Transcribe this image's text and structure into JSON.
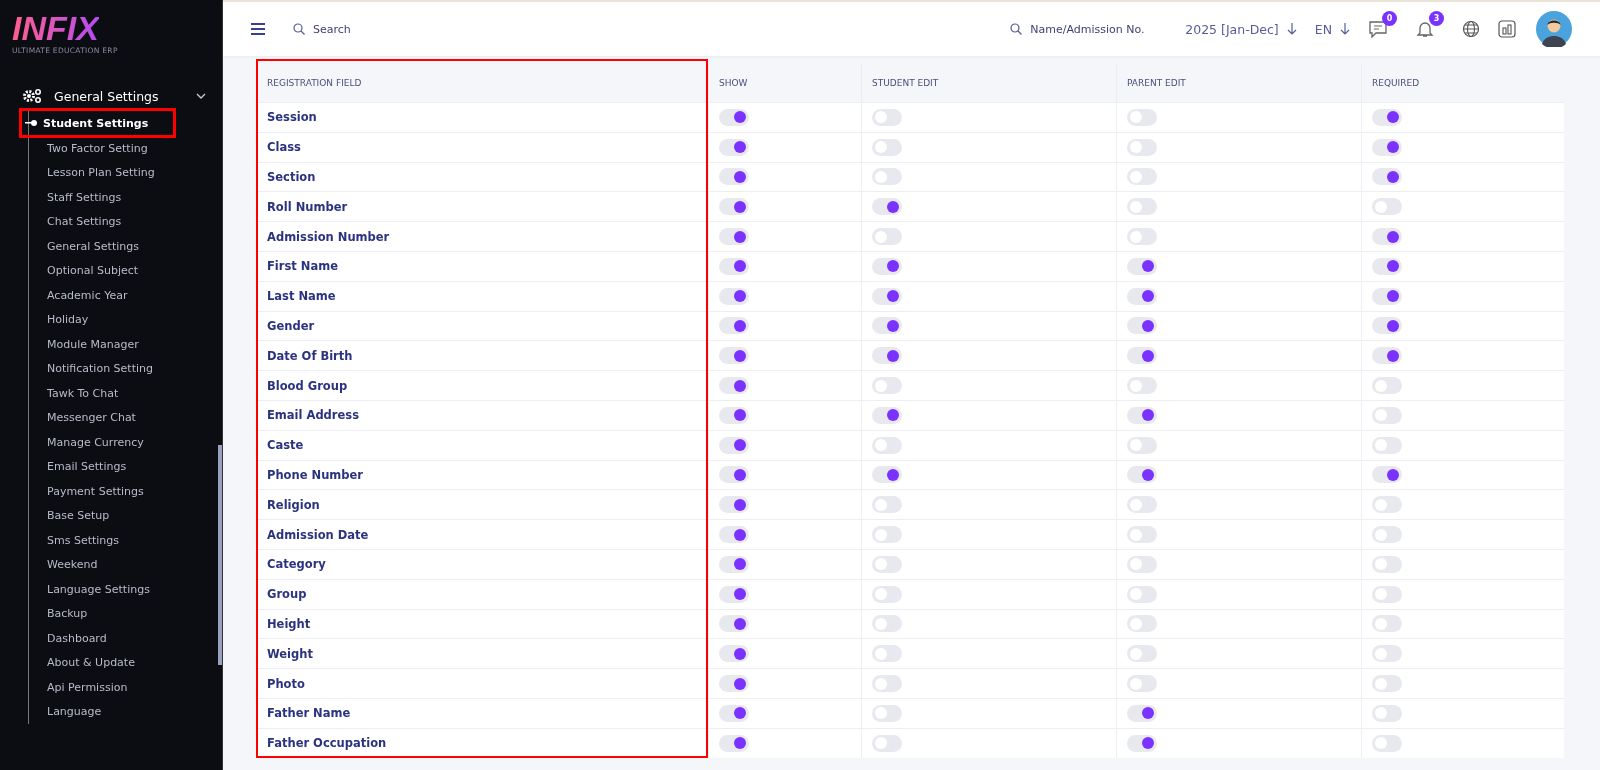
{
  "logo": {
    "name": "INFIX",
    "tagline": "ULTIMATE EDUCATION ERP"
  },
  "sidebar": {
    "group": {
      "label": "General Settings",
      "expanded": true
    },
    "items": [
      {
        "label": "Student Settings",
        "selected": true,
        "highlighted": true
      },
      {
        "label": "Two Factor Setting",
        "selected": false
      },
      {
        "label": "Lesson Plan Setting",
        "selected": false
      },
      {
        "label": "Staff Settings",
        "selected": false
      },
      {
        "label": "Chat Settings",
        "selected": false
      },
      {
        "label": "General Settings",
        "selected": false
      },
      {
        "label": "Optional Subject",
        "selected": false
      },
      {
        "label": "Academic Year",
        "selected": false
      },
      {
        "label": "Holiday",
        "selected": false
      },
      {
        "label": "Module Manager",
        "selected": false
      },
      {
        "label": "Notification Setting",
        "selected": false
      },
      {
        "label": "Tawk To Chat",
        "selected": false
      },
      {
        "label": "Messenger Chat",
        "selected": false
      },
      {
        "label": "Manage Currency",
        "selected": false
      },
      {
        "label": "Email Settings",
        "selected": false
      },
      {
        "label": "Payment Settings",
        "selected": false
      },
      {
        "label": "Base Setup",
        "selected": false
      },
      {
        "label": "Sms Settings",
        "selected": false
      },
      {
        "label": "Weekend",
        "selected": false
      },
      {
        "label": "Language Settings",
        "selected": false
      },
      {
        "label": "Backup",
        "selected": false
      },
      {
        "label": "Dashboard",
        "selected": false
      },
      {
        "label": "About & Update",
        "selected": false
      },
      {
        "label": "Api Permission",
        "selected": false
      },
      {
        "label": "Language",
        "selected": false
      }
    ]
  },
  "topbar": {
    "search_placeholder": "Search",
    "student_search_placeholder": "Name/Admission No.",
    "session": "2025 [Jan-Dec]",
    "language": "EN",
    "messages_count": "0",
    "notifications_count": "3"
  },
  "table": {
    "columns": [
      {
        "label": "REGISTRATION FIELD",
        "highlighted": true
      },
      {
        "label": "SHOW"
      },
      {
        "label": "STUDENT EDIT"
      },
      {
        "label": "PARENT EDIT"
      },
      {
        "label": "REQUIRED"
      }
    ],
    "rows": [
      {
        "field": "Session",
        "show": true,
        "student_edit": false,
        "parent_edit": false,
        "required": true
      },
      {
        "field": "Class",
        "show": true,
        "student_edit": false,
        "parent_edit": false,
        "required": true
      },
      {
        "field": "Section",
        "show": true,
        "student_edit": false,
        "parent_edit": false,
        "required": true
      },
      {
        "field": "Roll Number",
        "show": true,
        "student_edit": true,
        "parent_edit": false,
        "required": false
      },
      {
        "field": "Admission Number",
        "show": true,
        "student_edit": false,
        "parent_edit": false,
        "required": true
      },
      {
        "field": "First Name",
        "show": true,
        "student_edit": true,
        "parent_edit": true,
        "required": true
      },
      {
        "field": "Last Name",
        "show": true,
        "student_edit": true,
        "parent_edit": true,
        "required": true
      },
      {
        "field": "Gender",
        "show": true,
        "student_edit": true,
        "parent_edit": true,
        "required": true
      },
      {
        "field": "Date Of Birth",
        "show": true,
        "student_edit": true,
        "parent_edit": true,
        "required": true
      },
      {
        "field": "Blood Group",
        "show": true,
        "student_edit": false,
        "parent_edit": false,
        "required": false
      },
      {
        "field": "Email Address",
        "show": true,
        "student_edit": true,
        "parent_edit": true,
        "required": false
      },
      {
        "field": "Caste",
        "show": true,
        "student_edit": false,
        "parent_edit": false,
        "required": false
      },
      {
        "field": "Phone Number",
        "show": true,
        "student_edit": true,
        "parent_edit": true,
        "required": true
      },
      {
        "field": "Religion",
        "show": true,
        "student_edit": false,
        "parent_edit": false,
        "required": false
      },
      {
        "field": "Admission Date",
        "show": true,
        "student_edit": false,
        "parent_edit": false,
        "required": false
      },
      {
        "field": "Category",
        "show": true,
        "student_edit": false,
        "parent_edit": false,
        "required": false
      },
      {
        "field": "Group",
        "show": true,
        "student_edit": false,
        "parent_edit": false,
        "required": false
      },
      {
        "field": "Height",
        "show": true,
        "student_edit": false,
        "parent_edit": false,
        "required": false
      },
      {
        "field": "Weight",
        "show": true,
        "student_edit": false,
        "parent_edit": false,
        "required": false
      },
      {
        "field": "Photo",
        "show": true,
        "student_edit": false,
        "parent_edit": false,
        "required": false
      },
      {
        "field": "Father Name",
        "show": true,
        "student_edit": false,
        "parent_edit": true,
        "required": false
      },
      {
        "field": "Father Occupation",
        "show": true,
        "student_edit": false,
        "parent_edit": true,
        "required": false
      }
    ]
  }
}
